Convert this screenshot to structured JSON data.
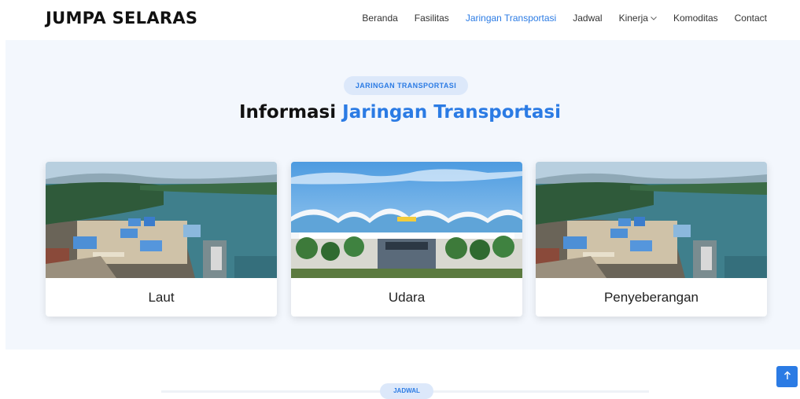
{
  "brand": "JUMPA SELARAS",
  "nav": {
    "items": [
      {
        "label": "Beranda"
      },
      {
        "label": "Fasilitas"
      },
      {
        "label": "Jaringan Transportasi"
      },
      {
        "label": "Jadwal"
      },
      {
        "label": "Kinerja"
      },
      {
        "label": "Komoditas"
      },
      {
        "label": "Contact"
      }
    ],
    "active_index": 2,
    "dropdown_icon": "chevron-down-icon"
  },
  "section": {
    "badge": "JARINGAN TRANSPORTASI",
    "heading_prefix": "Informasi",
    "heading_accent": "Jaringan Transportasi",
    "cards": [
      {
        "label": "Laut"
      },
      {
        "label": "Udara"
      },
      {
        "label": "Penyeberangan"
      }
    ]
  },
  "next_section": {
    "badge": "JADWAL"
  },
  "back_to_top_icon": "arrow-up-icon",
  "colors": {
    "accent": "#2b7be4",
    "section_bg": "#f3f7fd",
    "badge_bg": "#dce8fa"
  }
}
